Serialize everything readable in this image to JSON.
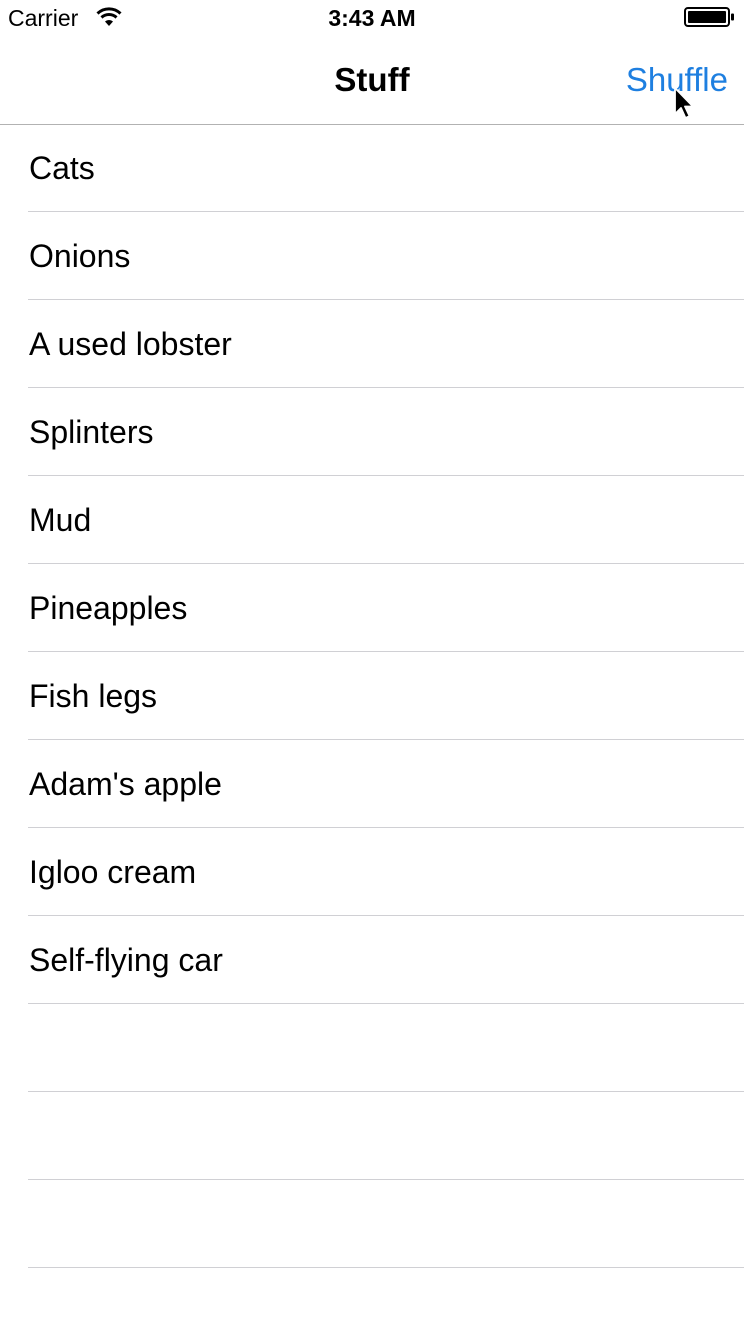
{
  "status_bar": {
    "carrier": "Carrier",
    "time": "3:43 AM",
    "wifi_icon": "wifi-icon",
    "battery_icon": "battery-full-icon"
  },
  "nav_bar": {
    "title": "Stuff",
    "action_label": "Shuffle",
    "action_color": "#1e7fe0"
  },
  "table": {
    "items": [
      {
        "label": "Cats"
      },
      {
        "label": "Onions"
      },
      {
        "label": "A used lobster"
      },
      {
        "label": "Splinters"
      },
      {
        "label": "Mud"
      },
      {
        "label": "Pineapples"
      },
      {
        "label": "Fish legs"
      },
      {
        "label": "Adam's apple"
      },
      {
        "label": "Igloo cream"
      },
      {
        "label": "Self-flying car"
      },
      {
        "label": ""
      },
      {
        "label": ""
      },
      {
        "label": ""
      }
    ]
  },
  "cursor_icon": "mouse-pointer-icon"
}
